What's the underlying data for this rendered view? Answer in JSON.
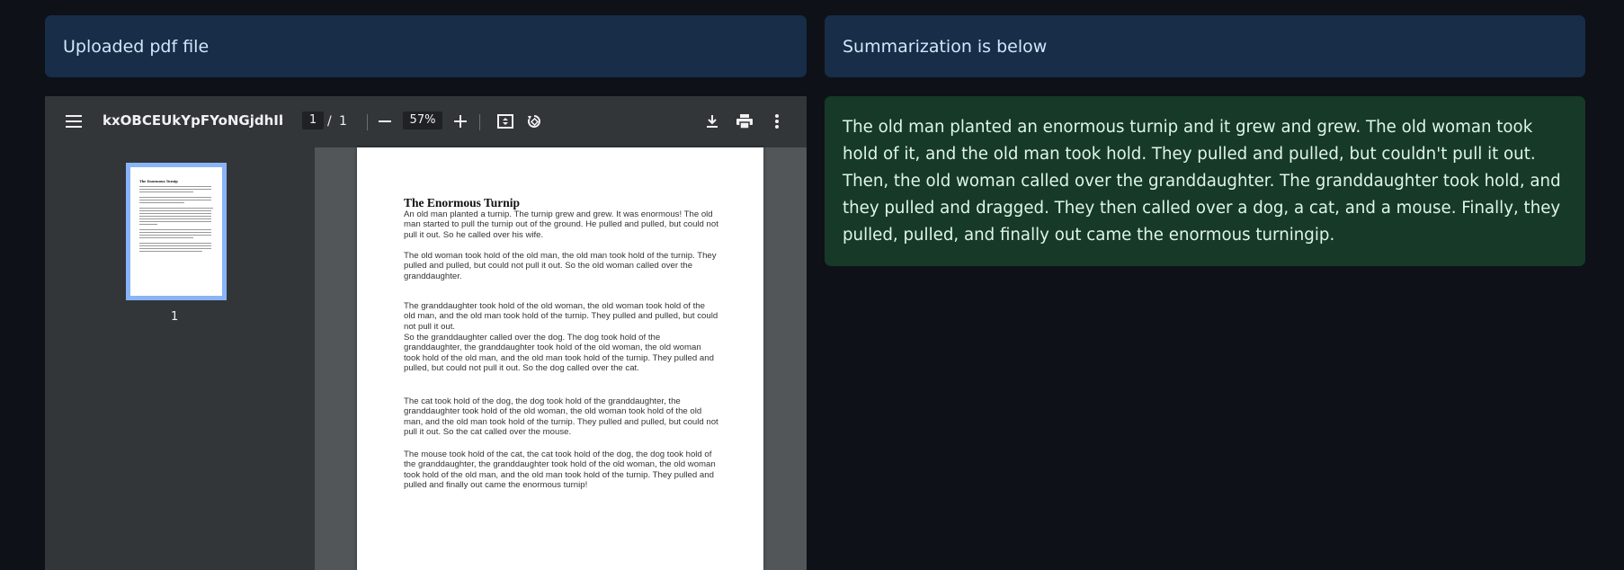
{
  "headers": {
    "left": "Uploaded pdf file",
    "right": "Summarization is below"
  },
  "pdf_viewer": {
    "filename": "kxOBCEUkYpFYoNGjdhIb6d7i...",
    "current_page": "1",
    "page_separator": "/",
    "total_pages": "1",
    "zoom": "57%",
    "thumbnail_label": "1",
    "icons": [
      "menu-icon",
      "zoom-out-icon",
      "zoom-in-icon",
      "fit-page-icon",
      "rotate-icon",
      "download-icon",
      "print-icon",
      "more-options-icon"
    ]
  },
  "document": {
    "title": "The Enormous Turnip",
    "paragraphs": [
      "An old man planted a turnip. The turnip grew and grew. It was enormous! The old man started to pull the turnip out of the ground. He pulled and pulled, but could not pull it out. So he called over his wife.",
      "The old woman took hold of the old man, the old man took hold of the turnip. They pulled and pulled, but could not pull it out. So the old woman called over the granddaughter.",
      "The granddaughter took hold of the old woman, the old woman took hold of the old man, and the old man took hold of the turnip. They pulled and pulled, but could not pull it out.",
      "So the granddaughter called over the dog. The dog took hold of the granddaughter, the granddaughter took hold of the old woman, the old woman took hold of the old man, and the old man took hold of the turnip. They pulled and pulled, but could not pull it out. So the dog called over the cat.",
      "The cat took hold of the dog, the dog took hold of the granddaughter, the granddaughter took hold of the old woman, the old woman took hold of the old man, and the old man took hold of the turnip. They pulled and pulled, but could not pull it out. So the cat called over the mouse.",
      "The mouse took hold of the cat, the cat took hold of the dog, the dog took hold of the granddaughter, the granddaughter took hold of the old woman, the old woman took hold of the old man, and the old man took hold of the turnip. They pulled and pulled and finally out came the enormous turnip!"
    ]
  },
  "summary": {
    "text": "The old man planted an enormous turnip and it grew and grew. The old woman took hold of it, and the old man took hold. They pulled and pulled, but couldn't pull it out. Then, the old woman called over the granddaughter. The granddaughter took hold, and they pulled and dragged. They then called over a dog, a cat, and a mouse. Finally, they pulled, pulled, and finally out came the enormous turningip."
  },
  "colors": {
    "background": "#0e1117",
    "header_box": "#172d48",
    "summary_box": "#173928",
    "toolbar": "#323639",
    "thumbnail_border": "#8ab4f8"
  }
}
